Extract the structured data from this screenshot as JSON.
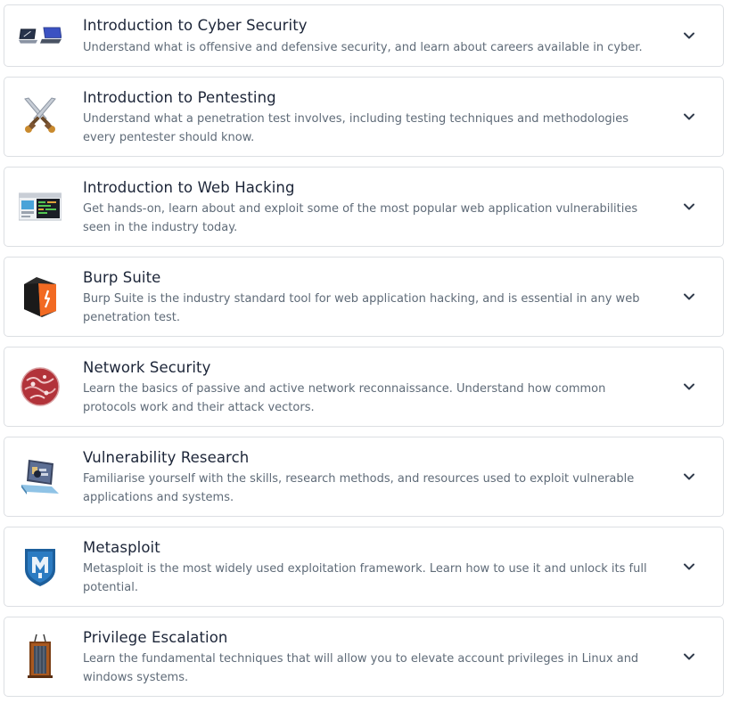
{
  "modules": [
    {
      "title": "Introduction to Cyber Security",
      "description": "Understand what is offensive and defensive security, and learn about careers available in cyber.",
      "icon": "laptops-icon"
    },
    {
      "title": "Introduction to Pentesting",
      "description": "Understand what a penetration test involves, including testing techniques and methodologies every pentester should know.",
      "icon": "crossed-swords-icon"
    },
    {
      "title": "Introduction to Web Hacking",
      "description": "Get hands-on, learn about and exploit some of the most popular web application vulnerabilities seen in the industry today.",
      "icon": "web-browser-code-icon"
    },
    {
      "title": "Burp Suite",
      "description": "Burp Suite is the industry standard tool for web application hacking, and is essential in any web penetration test.",
      "icon": "burp-suite-icon"
    },
    {
      "title": "Network Security",
      "description": "Learn the basics of passive and active network reconnaissance. Understand how common protocols work and their attack vectors.",
      "icon": "network-sphere-icon"
    },
    {
      "title": "Vulnerability Research",
      "description": "Familiarise yourself with the skills, research methods, and resources used to exploit vulnerable applications and systems.",
      "icon": "laptop-research-icon"
    },
    {
      "title": "Metasploit",
      "description": "Metasploit is the most widely used exploitation framework. Learn how to use it and unlock its full potential.",
      "icon": "metasploit-shield-icon"
    },
    {
      "title": "Privilege Escalation",
      "description": "Learn the fundamental techniques that will allow you to elevate account privileges in Linux and windows systems.",
      "icon": "elevator-icon"
    }
  ]
}
